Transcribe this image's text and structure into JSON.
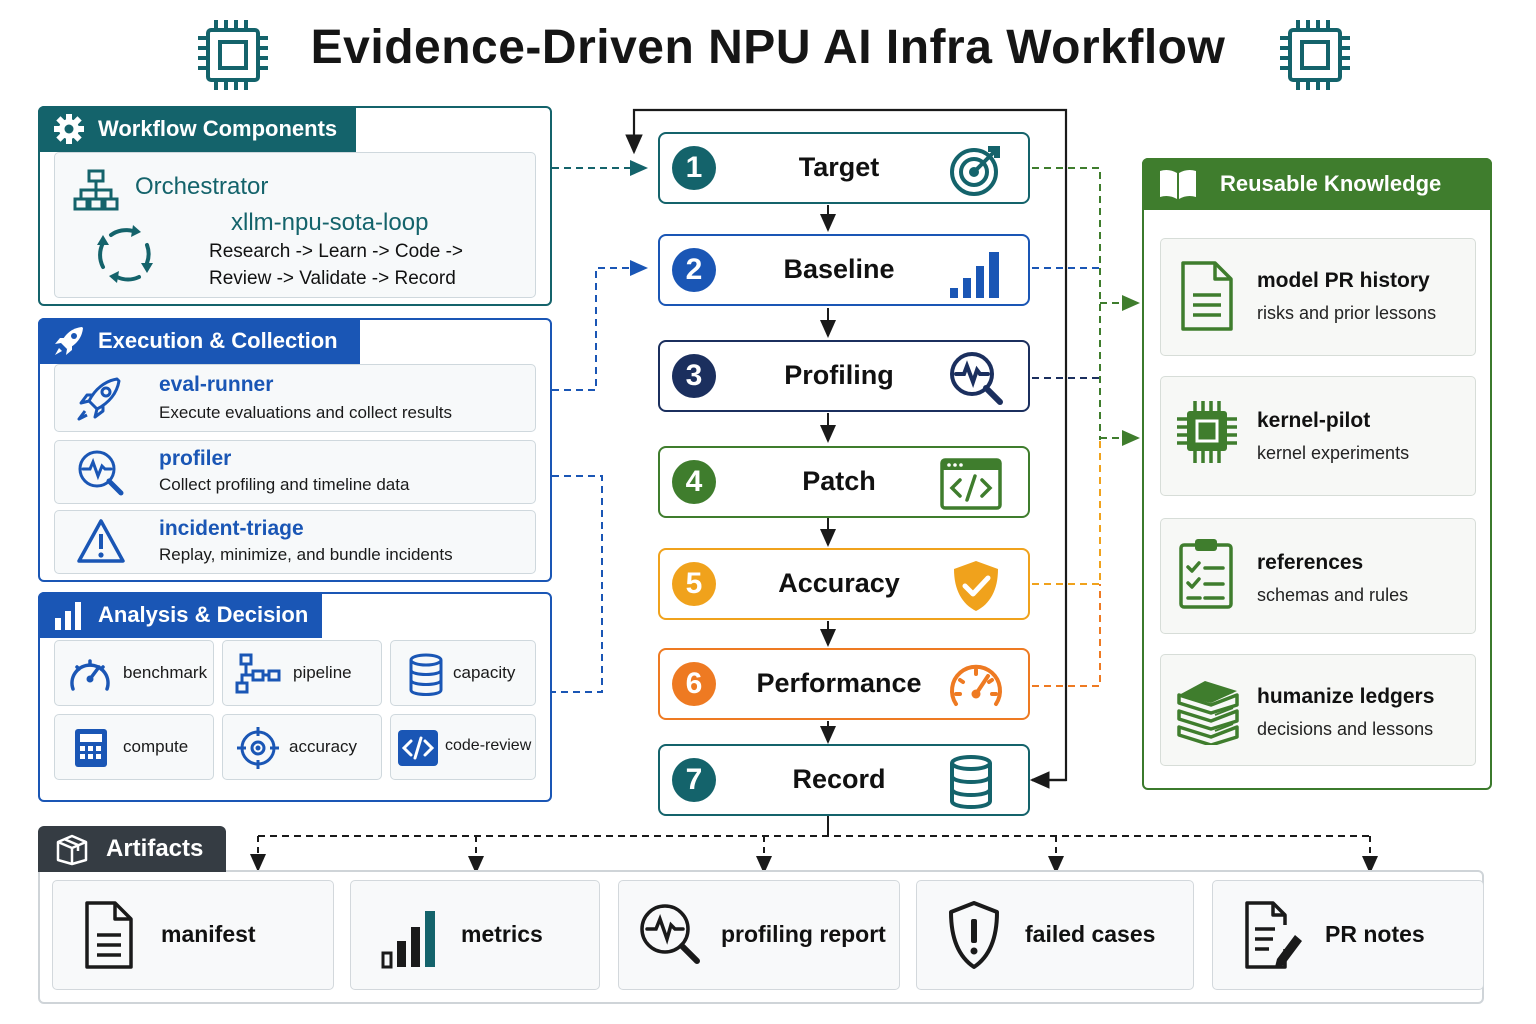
{
  "title": "Evidence-Driven NPU AI Infra Workflow",
  "colors": {
    "teal": "#14636b",
    "blue": "#1a56b5",
    "navy": "#1b2f5e",
    "green": "#3f7d2d",
    "yellow": "#f0a21c",
    "orange": "#ee7a22",
    "dark": "#353c43"
  },
  "workflow_components": {
    "header": "Workflow Components",
    "orchestrator_label": "Orchestrator",
    "loop_name": "xllm-npu-sota-loop",
    "loop_line1": "Research -> Learn -> Code ->",
    "loop_line2": "Review -> Validate -> Record"
  },
  "execution": {
    "header": "Execution & Collection",
    "items": [
      {
        "name": "eval-runner",
        "desc": "Execute evaluations and collect results",
        "icon": "rocket-icon"
      },
      {
        "name": "profiler",
        "desc": "Collect profiling and timeline data",
        "icon": "pulse-magnifier-icon"
      },
      {
        "name": "incident-triage",
        "desc": "Replay, minimize, and bundle incidents",
        "icon": "warning-icon"
      }
    ]
  },
  "analysis": {
    "header": "Analysis & Decision",
    "tools": [
      {
        "label": "benchmark",
        "icon": "gauge-icon"
      },
      {
        "label": "pipeline",
        "icon": "pipeline-icon"
      },
      {
        "label": "capacity",
        "icon": "database-icon"
      },
      {
        "label": "compute",
        "icon": "calculator-icon"
      },
      {
        "label": "accuracy",
        "icon": "crosshair-icon"
      },
      {
        "label": "code-review",
        "icon": "code-icon"
      }
    ]
  },
  "steps": [
    {
      "num": "1",
      "label": "Target",
      "icon": "target-icon"
    },
    {
      "num": "2",
      "label": "Baseline",
      "icon": "bar-chart-icon"
    },
    {
      "num": "3",
      "label": "Profiling",
      "icon": "pulse-magnifier-icon"
    },
    {
      "num": "4",
      "label": "Patch",
      "icon": "code-window-icon"
    },
    {
      "num": "5",
      "label": "Accuracy",
      "icon": "shield-check-icon"
    },
    {
      "num": "6",
      "label": "Performance",
      "icon": "speedometer-icon"
    },
    {
      "num": "7",
      "label": "Record",
      "icon": "database-icon"
    }
  ],
  "knowledge": {
    "header": "Reusable Knowledge",
    "items": [
      {
        "title": "model PR history",
        "sub": "risks and prior lessons",
        "icon": "document-icon"
      },
      {
        "title": "kernel-pilot",
        "sub": "kernel experiments",
        "icon": "chip-icon"
      },
      {
        "title": "references",
        "sub": "schemas and rules",
        "icon": "clipboard-checklist-icon"
      },
      {
        "title": "humanize ledgers",
        "sub": "decisions and lessons",
        "icon": "books-icon"
      }
    ]
  },
  "artifacts": {
    "header": "Artifacts",
    "items": [
      {
        "label": "manifest",
        "icon": "document-icon"
      },
      {
        "label": "metrics",
        "icon": "bar-chart-icon"
      },
      {
        "label": "profiling report",
        "icon": "pulse-magnifier-icon"
      },
      {
        "label": "failed cases",
        "icon": "shield-alert-icon"
      },
      {
        "label": "PR notes",
        "icon": "document-pen-icon"
      }
    ]
  }
}
